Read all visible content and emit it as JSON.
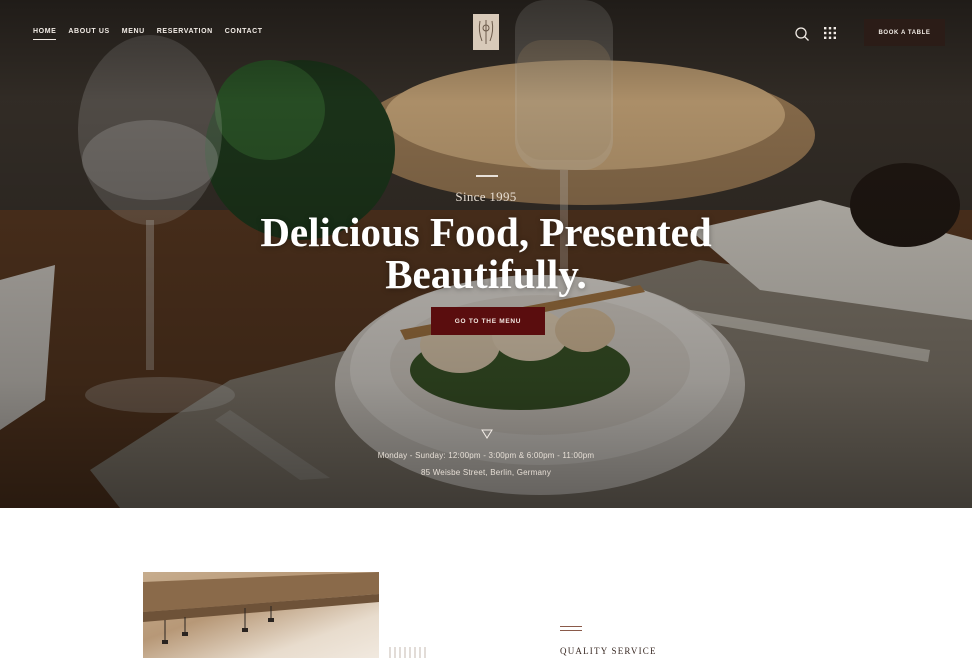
{
  "nav": {
    "items": [
      "HOME",
      "ABOUT US",
      "MENU",
      "RESERVATION",
      "CONTACT"
    ],
    "active": "HOME"
  },
  "header": {
    "book_label": "BOOK A TABLE",
    "search_icon": "search-icon",
    "grid_icon": "grid-menu-icon"
  },
  "hero": {
    "since": "Since 1995",
    "headline_line1": "Delicious Food, Presented",
    "headline_line2": "Beautifully.",
    "cta_label": "GO TO THE MENU",
    "hours": "Monday - Sunday: 12:00pm - 3:00pm & 6:00pm - 11:00pm",
    "address": "85 Weisbe Street, Berlin, Germany"
  },
  "section": {
    "quality_label": "QUALITY SERVICE"
  },
  "colors": {
    "accent": "#5a0d0e",
    "dark_button": "#2b1c17",
    "logo_bg": "#d8cab9"
  }
}
